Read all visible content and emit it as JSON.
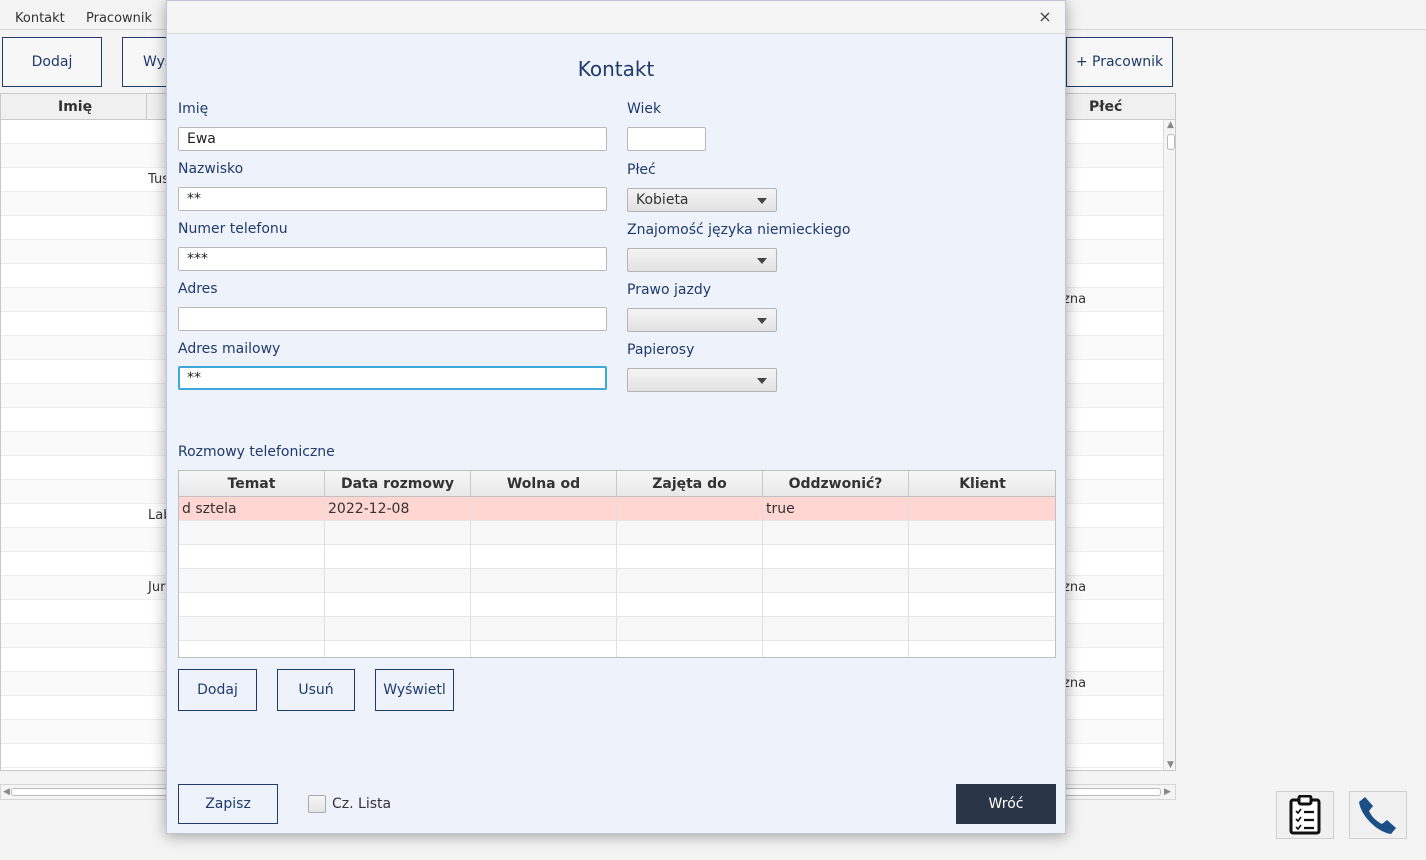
{
  "menubar": {
    "items": [
      "Kontakt",
      "Pracownik"
    ]
  },
  "toolbar": {
    "add_label": "Dodaj",
    "show_label_partial": "Wys",
    "add_worker_label": "+ Pracownik"
  },
  "main_table": {
    "columns": [
      "Imię",
      "Płeć"
    ],
    "visible_cells": [
      {
        "row": 2,
        "col": "surname",
        "text": "Tus"
      },
      {
        "row": 7,
        "col": "gender",
        "text": "zna"
      },
      {
        "row": 16,
        "col": "surname",
        "text": "Lab"
      },
      {
        "row": 19,
        "col": "surname",
        "text": "Jur"
      },
      {
        "row": 19,
        "col": "gender",
        "text": "zna"
      },
      {
        "row": 23,
        "col": "gender",
        "text": "zna"
      }
    ]
  },
  "dialog": {
    "close_glyph": "×",
    "title": "Kontakt",
    "fields": {
      "first_name": {
        "label": "Imię",
        "value": "Ewa"
      },
      "last_name": {
        "label": "Nazwisko",
        "value": "**"
      },
      "phone": {
        "label": "Numer telefonu",
        "value": "***"
      },
      "address": {
        "label": "Adres",
        "value": ""
      },
      "email": {
        "label": "Adres mailowy",
        "value": "**"
      },
      "age": {
        "label": "Wiek",
        "value": ""
      },
      "gender": {
        "label": "Płeć",
        "value": "Kobieta"
      },
      "german": {
        "label": "Znajomość języka niemieckiego",
        "value": ""
      },
      "driving_license": {
        "label": "Prawo jazdy",
        "value": ""
      },
      "cigarettes": {
        "label": "Papierosy",
        "value": ""
      }
    },
    "calls": {
      "label": "Rozmowy telefoniczne",
      "columns": [
        "Temat",
        "Data rozmowy",
        "Wolna od",
        "Zajęta do",
        "Oddzwonić?",
        "Klient"
      ],
      "rows": [
        [
          "d sztela",
          "2022-12-08",
          "",
          "",
          "true",
          ""
        ]
      ]
    },
    "call_buttons": {
      "add": "Dodaj",
      "remove": "Usuń",
      "show": "Wyświetl"
    },
    "save_label": "Zapisz",
    "checkbox_label": "Cz. Lista",
    "checkbox_checked": false,
    "back_label": "Wróć"
  },
  "corner_icons": [
    "clipboard-icon",
    "phone-icon"
  ],
  "colors": {
    "accent": "#1f3a6b",
    "selected_row": "#ffd6d2",
    "dark_button": "#2a3547",
    "focus": "#3ea8d8",
    "dialog_bg": "#eef2fb"
  }
}
